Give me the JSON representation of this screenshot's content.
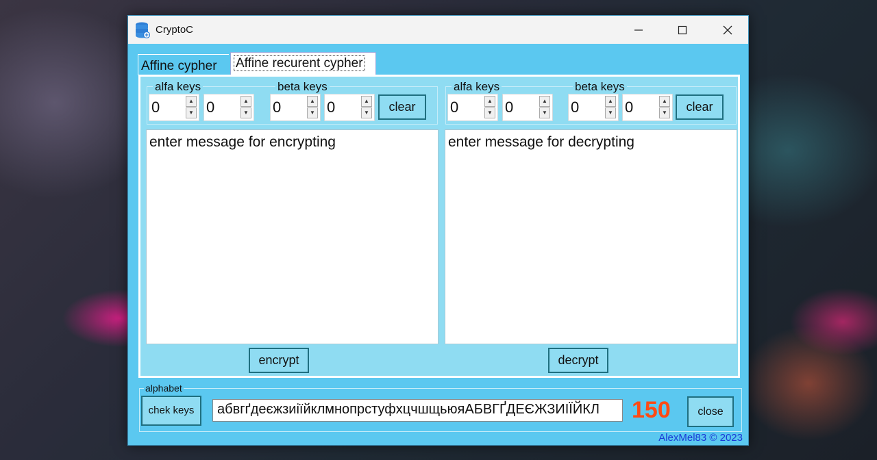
{
  "window": {
    "title": "CryptoC"
  },
  "tabs": [
    {
      "label": "Affine cypher"
    },
    {
      "label": "Affine recurent cypher"
    }
  ],
  "encrypt_panel": {
    "alfa_label": "alfa keys",
    "beta_label": "beta keys",
    "alfa_values": [
      "0",
      "0"
    ],
    "beta_values": [
      "0",
      "0"
    ],
    "clear_label": "clear",
    "message_placeholder": "enter message for encrypting",
    "action_label": "encrypt"
  },
  "decrypt_panel": {
    "alfa_label": "alfa keys",
    "beta_label": "beta keys",
    "alfa_values": [
      "0",
      "0"
    ],
    "beta_values": [
      "0",
      "0"
    ],
    "clear_label": "clear",
    "message_placeholder": "enter message for decrypting",
    "action_label": "decrypt"
  },
  "alphabet": {
    "label": "alphabet",
    "check_label": "chek keys",
    "value": "абвгґдеєжзиіїйклмнопрстуфхцчшщьюяАБВГҐДЕЄЖЗИІЇЙКЛ",
    "count": "150",
    "close_label": "close"
  },
  "footer": {
    "copyright": "AlexMel83 © 2023"
  },
  "colors": {
    "window_bg": "#5bc8f0",
    "panel_bg": "#8fdcf2",
    "count_color": "#ff4a13",
    "copyright_color": "#1a3ad6"
  },
  "icons": {
    "app": "database-icon",
    "minimize": "minimize-icon",
    "maximize": "maximize-icon",
    "close": "close-icon",
    "spin_up": "arrow-up-icon",
    "spin_down": "arrow-down-icon"
  }
}
